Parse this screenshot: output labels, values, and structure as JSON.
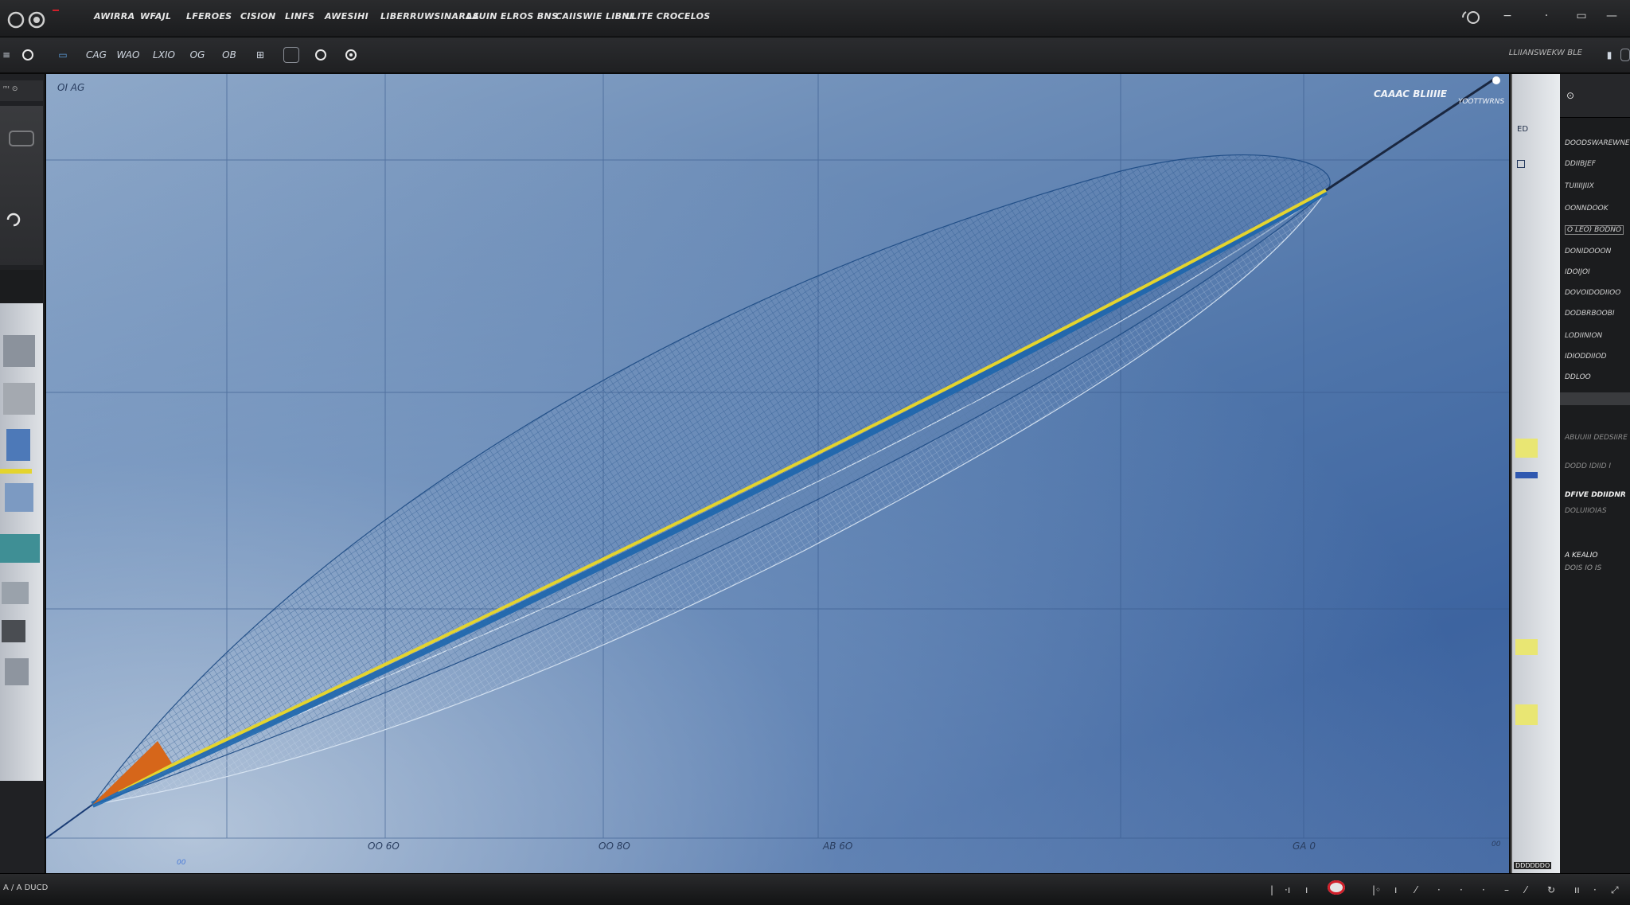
{
  "menubar": {
    "items": [
      "AWIRRA",
      "WFAJL",
      "LFEROES",
      "CISION",
      "LINFS",
      "AWESIHI",
      "LIBERRUWSINARAS",
      "LAUIN ELROS BNS",
      "CAIISWIE LIBNI",
      "LLITE CROCELOS"
    ],
    "window_controls": [
      "−",
      "·",
      "▭",
      "—"
    ]
  },
  "toolbar": {
    "tools": [
      "CAG",
      "WAO",
      "LXIO",
      "OG",
      "OB"
    ],
    "right_label": "LLIIANSWEKW BLE"
  },
  "viewport": {
    "corner_label": "OI AG",
    "top_right_label": "CAAAC BLIIIIE",
    "top_right_sub": "YOOTTWRNS",
    "axis_ticks": [
      "OO 6O",
      "OO 8O",
      "AB 6O",
      "GA 0"
    ],
    "small_tag": "00",
    "bottom_right_tag": "00"
  },
  "right_strip": {
    "header": "ED",
    "footer": "DDDDDDO"
  },
  "properties": {
    "items": [
      "DOODSWAREWNE",
      "DDIIBJEF",
      "TUIIIIJIIX",
      "OONNDOOK",
      "O LEO) BODNO",
      "DONIDOOON",
      "IDOIJOI",
      "DOVOIDODIIOO",
      "DODBRBOOBI",
      "LODIINION",
      "IDIODDIIOD",
      "DDLOO",
      "ABUUIII DEDSIIRE",
      "DODD IDIID I",
      "DOLUIIOIAS"
    ],
    "section_b": [
      "DFIVE DDIIDNR",
      "A KEALIO",
      "DOIS IO IS"
    ]
  },
  "statusbar": {
    "left_text": "A / A  DUCD"
  },
  "colors": {
    "accent_yellow": "#e4d42e",
    "accent_orange": "#d6661a",
    "record_red": "#d11f2a",
    "mesh_blue": "#1f4d86"
  }
}
